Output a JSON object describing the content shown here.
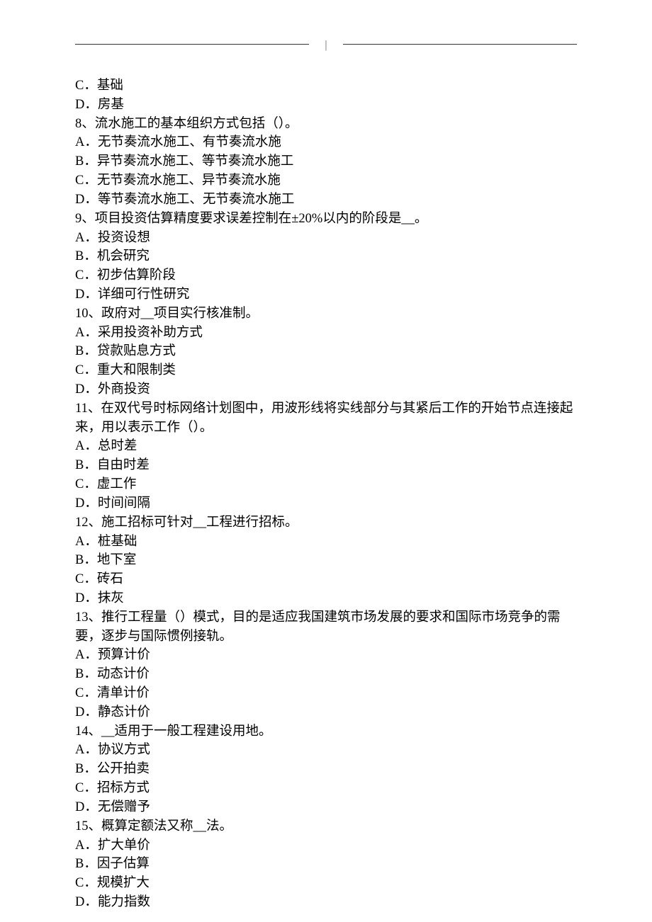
{
  "header": {
    "separator": "|"
  },
  "lines": [
    "C．基础",
    "D．房基",
    "8、流水施工的基本组织方式包括（）。",
    "A．无节奏流水施工、有节奏流水施",
    "B．异节奏流水施工、等节奏流水施工",
    "C．无节奏流水施工、异节奏流水施",
    "D．等节奏流水施工、无节奏流水施工",
    "9、项目投资估算精度要求误差控制在±20%以内的阶段是__。",
    "A．投资设想",
    "B．机会研究",
    "C．初步估算阶段",
    "D．详细可行性研究",
    "10、政府对__项目实行核准制。",
    "A．采用投资补助方式",
    "B．贷款贴息方式",
    "C．重大和限制类",
    "D．外商投资",
    "11、在双代号时标网络计划图中，用波形线将实线部分与其紧后工作的开始节点连接起来，用以表示工作（）。",
    "A．总时差",
    "B．自由时差",
    "C．虚工作",
    "D．时间间隔",
    "12、施工招标可针对__工程进行招标。",
    "A．桩基础",
    "B．地下室",
    "C．砖石",
    "D．抹灰",
    "13、推行工程量（）模式，目的是适应我国建筑市场发展的要求和国际市场竞争的需要，逐步与国际惯例接轨。",
    "A．预算计价",
    "B．动态计价",
    "C．清单计价",
    "D．静态计价",
    "14、__适用于一般工程建设用地。",
    "A．协议方式",
    "B．公开拍卖",
    "C．招标方式",
    "D．无偿赠予",
    "15、概算定额法又称__法。",
    "A．扩大单价",
    "B．因子估算",
    "C．规模扩大",
    "D．能力指数"
  ]
}
